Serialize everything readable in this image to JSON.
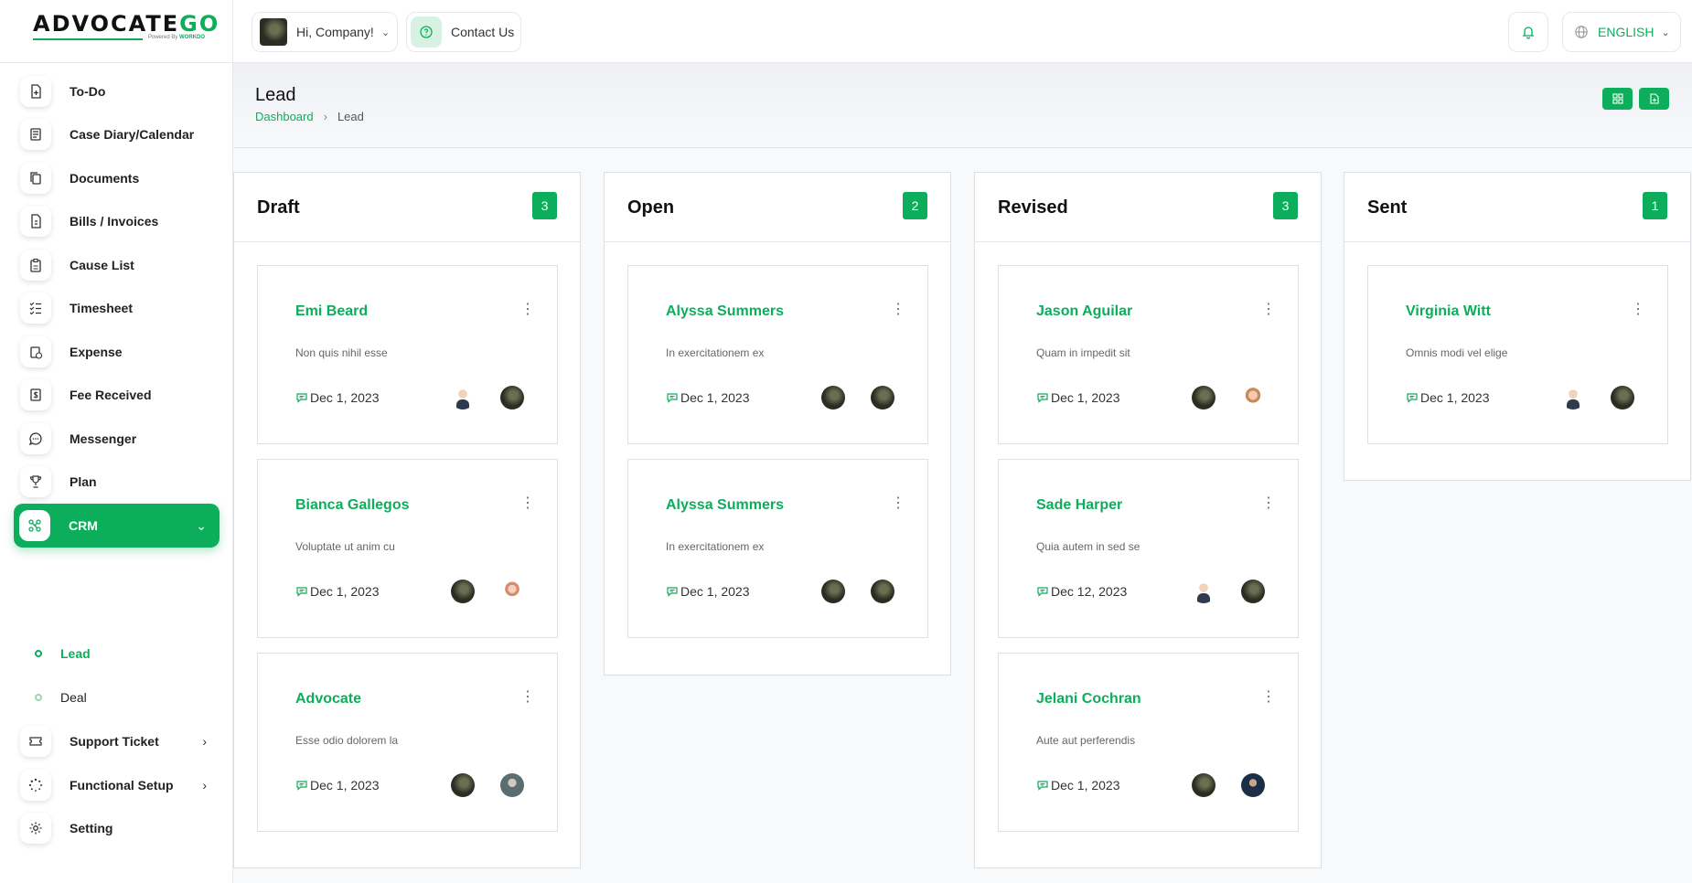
{
  "brand": {
    "name_main": "ADVOCATE",
    "name_accent": "GO",
    "powered_prefix": "Powered By",
    "powered_brand": "WORKDO"
  },
  "colors": {
    "accent": "#0cae5b"
  },
  "sidebar": {
    "items": [
      {
        "label": "To-Do",
        "icon": "todo-icon"
      },
      {
        "label": "Case Diary/Calendar",
        "icon": "diary-icon"
      },
      {
        "label": "Documents",
        "icon": "documents-icon"
      },
      {
        "label": "Bills / Invoices",
        "icon": "invoice-icon"
      },
      {
        "label": "Cause List",
        "icon": "clipboard-icon"
      },
      {
        "label": "Timesheet",
        "icon": "list-check-icon"
      },
      {
        "label": "Expense",
        "icon": "expense-icon"
      },
      {
        "label": "Fee Received",
        "icon": "fee-icon"
      },
      {
        "label": "Messenger",
        "icon": "chat-icon"
      },
      {
        "label": "Plan",
        "icon": "trophy-icon"
      },
      {
        "label": "CRM",
        "icon": "crm-icon",
        "active": true
      },
      {
        "label": "Support Ticket",
        "icon": "ticket-icon"
      },
      {
        "label": "Functional Setup",
        "icon": "loader-icon"
      },
      {
        "label": "Setting",
        "icon": "gear-icon"
      }
    ],
    "crm_sub": [
      {
        "label": "Lead",
        "active": true
      },
      {
        "label": "Deal"
      }
    ]
  },
  "topbar": {
    "greeting": "Hi, Company!",
    "contact": "Contact Us",
    "language": "ENGLISH"
  },
  "page": {
    "title": "Lead",
    "breadcrumb_home": "Dashboard",
    "breadcrumb_current": "Lead"
  },
  "columns": [
    {
      "title": "Draft",
      "count": "3",
      "cards": [
        {
          "name": "Emi Beard",
          "desc": "Non quis nihil esse",
          "date": "Dec 1, 2023",
          "avatars": [
            "man",
            "dark"
          ]
        },
        {
          "name": "Bianca Gallegos",
          "desc": "Voluptate ut anim cu",
          "date": "Dec 1, 2023",
          "avatars": [
            "dark",
            "blond"
          ]
        },
        {
          "name": "Advocate",
          "desc": "Esse odio dolorem la",
          "date": "Dec 1, 2023",
          "avatars": [
            "dark",
            "grey"
          ]
        }
      ]
    },
    {
      "title": "Open",
      "count": "2",
      "cards": [
        {
          "name": "Alyssa Summers",
          "desc": "In exercitationem ex",
          "date": "Dec 1, 2023",
          "avatars": [
            "dark",
            "dark"
          ]
        },
        {
          "name": "Alyssa Summers",
          "desc": "In exercitationem ex",
          "date": "Dec 1, 2023",
          "avatars": [
            "dark",
            "dark"
          ]
        }
      ]
    },
    {
      "title": "Revised",
      "count": "3",
      "cards": [
        {
          "name": "Jason Aguilar",
          "desc": "Quam in impedit sit",
          "date": "Dec 1, 2023",
          "avatars": [
            "dark",
            "woman"
          ]
        },
        {
          "name": "Sade Harper",
          "desc": "Quia autem in sed se",
          "date": "Dec 12, 2023",
          "avatars": [
            "man",
            "dark"
          ]
        },
        {
          "name": "Jelani Cochran",
          "desc": "Aute aut perferendis",
          "date": "Dec 1, 2023",
          "avatars": [
            "dark",
            "navy"
          ]
        }
      ]
    },
    {
      "title": "Sent",
      "count": "1",
      "cards": [
        {
          "name": "Virginia Witt",
          "desc": "Omnis modi vel elige",
          "date": "Dec 1, 2023",
          "avatars": [
            "man",
            "dark"
          ]
        }
      ]
    }
  ]
}
